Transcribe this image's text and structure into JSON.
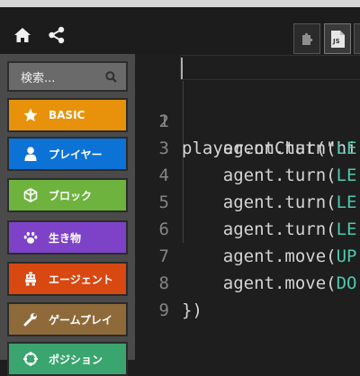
{
  "header": {
    "home_icon": "home-icon",
    "share_icon": "share-icon",
    "modes": {
      "blocks_icon": "puzzle-icon",
      "js_label": "JS"
    }
  },
  "sidebar": {
    "search": {
      "placeholder": "検索...",
      "icon": "search-icon"
    },
    "categories": [
      {
        "label": "BASIC",
        "icon": "star-icon",
        "color": "#e8920b"
      },
      {
        "label": "プレイヤー",
        "icon": "user-icon",
        "color": "#0c72d6"
      },
      {
        "label": "ブロック",
        "icon": "cube-icon",
        "color": "#6fb33f"
      },
      {
        "label": "生き物",
        "icon": "paw-icon",
        "color": "#7d42c7"
      },
      {
        "label": "エージェント",
        "icon": "robot-icon",
        "color": "#d84811"
      },
      {
        "label": "ゲームプレイ",
        "icon": "wrench-icon",
        "color": "#8e6a3a"
      },
      {
        "label": "ポジション",
        "icon": "position-icon",
        "color": "#3aa56f"
      }
    ]
  },
  "editor": {
    "lines": [
      {
        "num": "1",
        "text": "player.onChat(\"hi"
      },
      {
        "num": "2",
        "text": "    agent.turn(LE"
      },
      {
        "num": "3",
        "text": "    agent.turn(LE"
      },
      {
        "num": "4",
        "text": "    agent.turn(LE"
      },
      {
        "num": "5",
        "text": "    agent.turn(LE"
      },
      {
        "num": "6",
        "text": "    agent.move(UP"
      },
      {
        "num": "7",
        "text": "    agent.move(DO"
      },
      {
        "num": "8",
        "text": "})"
      },
      {
        "num": "9",
        "text": ""
      }
    ]
  }
}
